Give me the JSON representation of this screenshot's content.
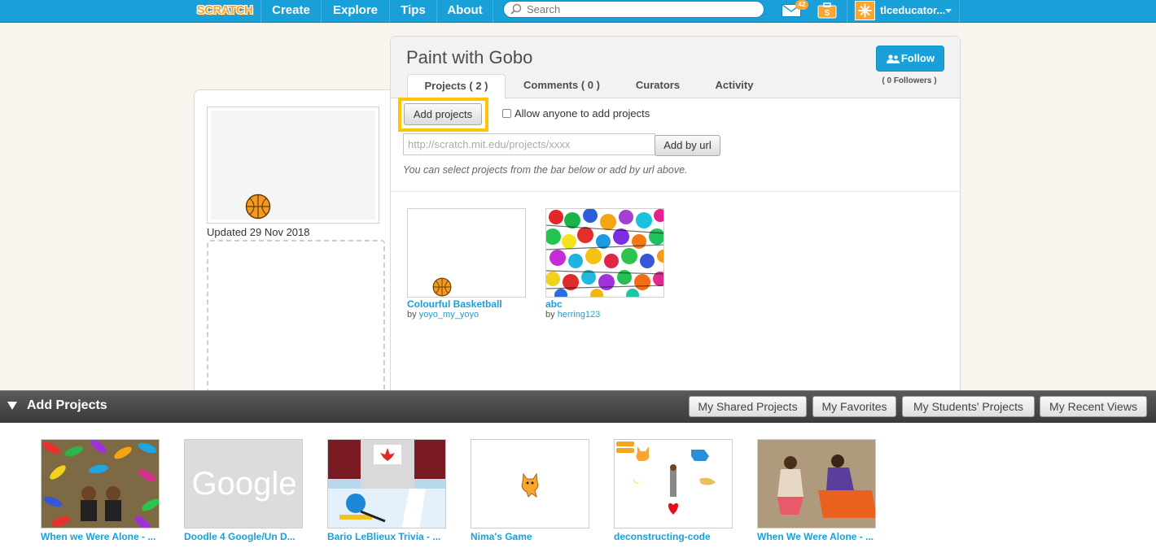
{
  "nav": {
    "logo": "SCRATCH",
    "links": [
      "Create",
      "Explore",
      "Tips",
      "About"
    ],
    "search_placeholder": "Search",
    "message_count": "42",
    "username": "tlceducator..."
  },
  "studio": {
    "title": "Paint with Gobo",
    "follow_label": "Follow",
    "followers": "( 0 Followers )",
    "tabs": [
      "Projects ( 2 )",
      "Comments ( 0 )",
      "Curators",
      "Activity"
    ],
    "add_projects_label": "Add projects",
    "allow_label": "Allow anyone to add projects",
    "url_placeholder": "http://scratch.mit.edu/projects/xxxx",
    "add_by_url_label": "Add by url",
    "hint": "You can select projects from the bar below or add by url above.",
    "updated": "Updated 29 Nov 2018",
    "projects": [
      {
        "title": "Colourful Basketball",
        "by": "by",
        "author": "yoyo_my_yoyo"
      },
      {
        "title": "abc",
        "by": "by",
        "author": "herring123"
      }
    ]
  },
  "tray": {
    "title": "Add Projects",
    "filters": [
      "My Shared Projects",
      "My Favorites",
      "My Students' Projects",
      "My Recent Views"
    ],
    "items": [
      {
        "title": "When we Were Alone - ..."
      },
      {
        "title": "Doodle 4 Google/Un D..."
      },
      {
        "title": "Bario LeBlieux Trivia - ..."
      },
      {
        "title": "Nima's Game"
      },
      {
        "title": "deconstructing-code"
      },
      {
        "title": "When We Were Alone - ..."
      }
    ],
    "google_thumb_text": "Google"
  },
  "colors": {
    "nav_blue": "#1aa0d8",
    "link_blue": "#1aa0d8",
    "highlight": "#ffc600",
    "scratch_orange": "#f9a631"
  }
}
